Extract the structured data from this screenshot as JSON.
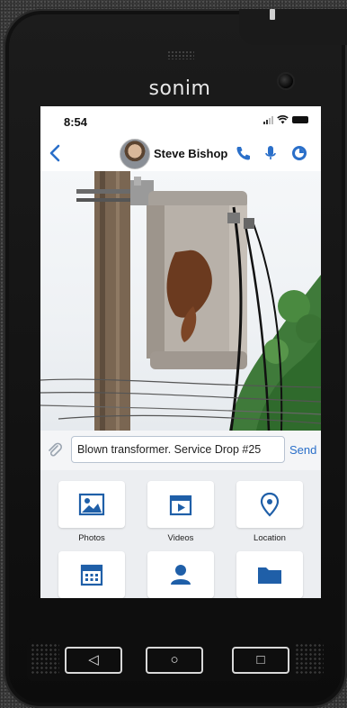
{
  "device": {
    "brand": "sonim"
  },
  "status_bar": {
    "time": "8:54"
  },
  "chat": {
    "contact_name": "Steve Bishop"
  },
  "composer": {
    "message": "Blown transformer. Service Drop #25",
    "send_label": "Send"
  },
  "attachments": [
    {
      "label": "Photos",
      "icon": "photo-icon"
    },
    {
      "label": "Videos",
      "icon": "video-icon"
    },
    {
      "label": "Location",
      "icon": "location-pin-icon"
    },
    {
      "label": "",
      "icon": "calendar-icon"
    },
    {
      "label": "",
      "icon": "contact-icon"
    },
    {
      "label": "",
      "icon": "folder-icon"
    }
  ],
  "nav_keys": [
    {
      "icon": "back-triangle-icon",
      "glyph": "◁"
    },
    {
      "icon": "home-circle-icon",
      "glyph": "○"
    },
    {
      "icon": "recents-square-icon",
      "glyph": "□"
    }
  ],
  "colors": {
    "accent": "#2a6fc9",
    "tile_icon": "#1f5fa8"
  }
}
